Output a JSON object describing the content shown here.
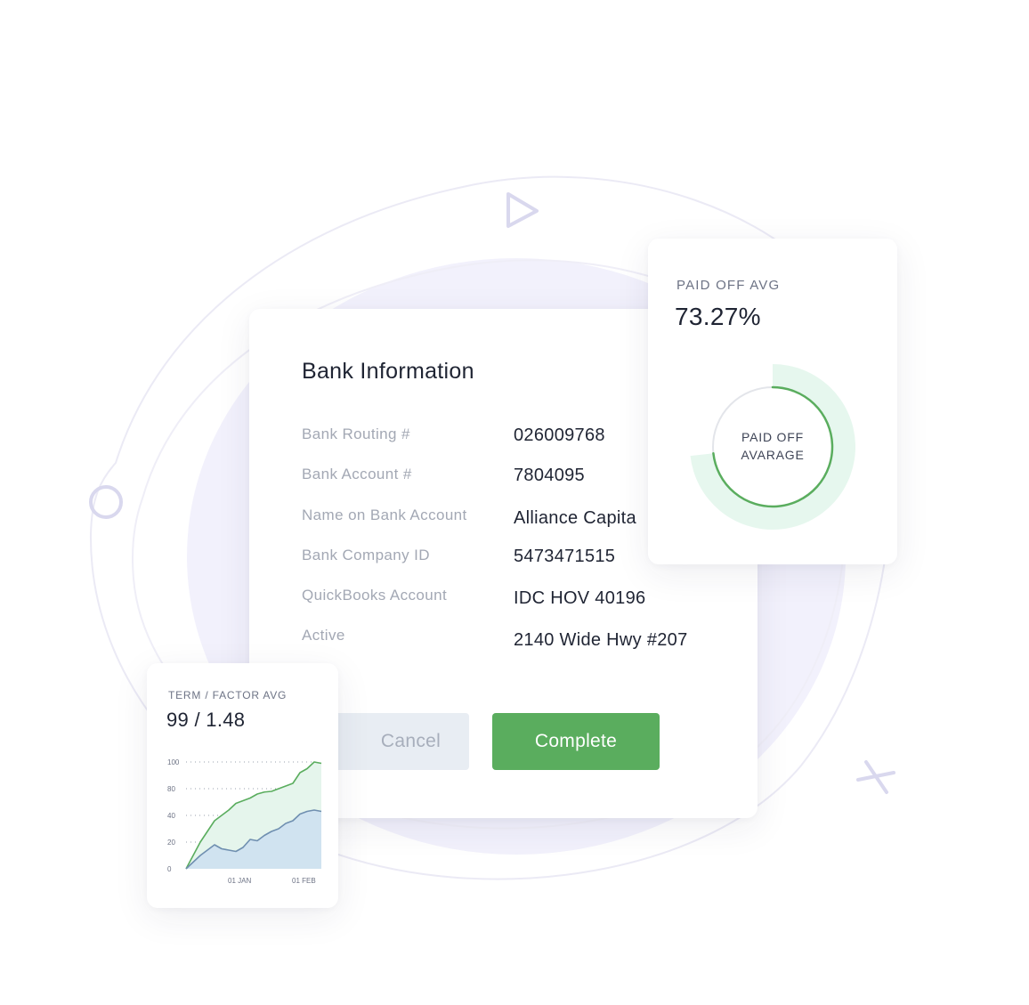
{
  "bank": {
    "title": "Bank Information",
    "fields": [
      {
        "label": "Bank Routing #",
        "value": "026009768"
      },
      {
        "label": "Bank Account #",
        "value": "7804095"
      },
      {
        "label": "Name on Bank Account",
        "value": "Alliance Capita"
      },
      {
        "label": "Bank Company ID",
        "value": "5473471515"
      },
      {
        "label": "QuickBooks Account",
        "value": "IDC HOV 40196"
      },
      {
        "label": "Active",
        "value": "2140 Wide Hwy #207"
      }
    ],
    "cancel_label": "Cancel",
    "complete_label": "Complete"
  },
  "paid_off": {
    "label": "PAID OFF AVG",
    "value": "73.27%",
    "donut_line1": "PAID OFF",
    "donut_line2": "AVARAGE",
    "fraction": 0.7327
  },
  "term": {
    "label": "TERM / FACTOR AVG",
    "value": "99 / 1.48"
  },
  "chart_data": {
    "type": "area",
    "title": "",
    "xlabel": "",
    "ylabel": "",
    "x_ticks": [
      "01 JAN",
      "01 FEB"
    ],
    "y_ticks": [
      0,
      20,
      40,
      80,
      100
    ],
    "ylim": [
      0,
      100
    ],
    "grid": true,
    "series": [
      {
        "values": [
          0,
          10,
          20,
          28,
          36,
          40,
          48,
          58,
          62,
          66,
          72,
          75,
          76,
          80,
          82,
          84,
          92,
          95,
          100,
          99
        ]
      },
      {
        "values": [
          0,
          5,
          10,
          14,
          18,
          15,
          14,
          13,
          16,
          22,
          21,
          25,
          28,
          30,
          34,
          36,
          42,
          46,
          48,
          46
        ]
      }
    ],
    "colors": {
      "series1": "#5aad5e",
      "series2": "#6f8fb0"
    }
  },
  "colors": {
    "accent": "#5aad5e",
    "blob": "#f2f1fc",
    "outline": "#e9e8f4",
    "shape": "#d9d8ee"
  }
}
